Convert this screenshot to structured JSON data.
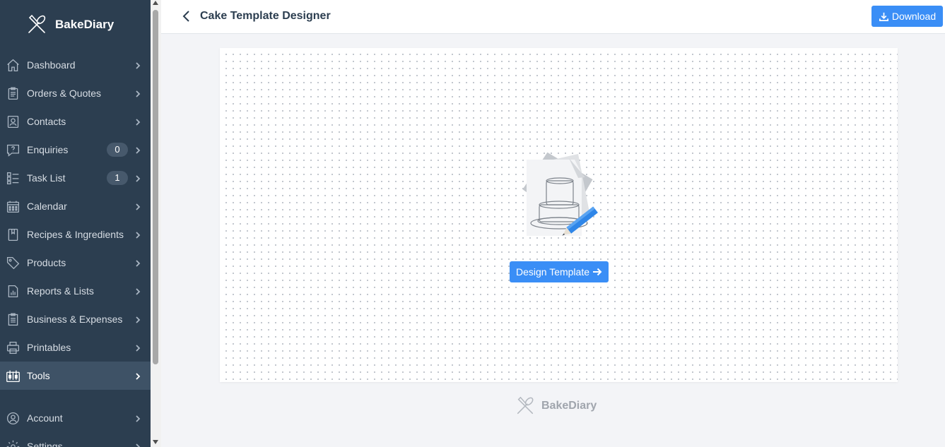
{
  "app": {
    "brand_name": "BakeDiary"
  },
  "sidebar": {
    "items": [
      {
        "label": "Dashboard",
        "icon": "home-icon"
      },
      {
        "label": "Orders & Quotes",
        "icon": "clipboard-icon"
      },
      {
        "label": "Contacts",
        "icon": "contact-card-icon"
      },
      {
        "label": "Enquiries",
        "icon": "question-bubble-icon",
        "badge": "0"
      },
      {
        "label": "Task List",
        "icon": "checklist-icon",
        "badge": "1"
      },
      {
        "label": "Calendar",
        "icon": "calendar-icon"
      },
      {
        "label": "Recipes & Ingredients",
        "icon": "recipe-book-icon"
      },
      {
        "label": "Products",
        "icon": "tag-icon"
      },
      {
        "label": "Reports & Lists",
        "icon": "report-icon"
      },
      {
        "label": "Business & Expenses",
        "icon": "receipt-icon"
      },
      {
        "label": "Printables",
        "icon": "printer-icon"
      },
      {
        "label": "Tools",
        "icon": "tools-icon",
        "active": true
      },
      {
        "label": "Account",
        "icon": "account-icon"
      },
      {
        "label": "Settings",
        "icon": "gear-icon"
      }
    ]
  },
  "header": {
    "title": "Cake Template Designer",
    "download_label": "Download"
  },
  "main": {
    "design_button_label": "Design Template"
  },
  "footer": {
    "brand_name": "BakeDiary"
  },
  "colors": {
    "sidebar_bg": "#2c3e50",
    "sidebar_active": "#3e5266",
    "accent": "#3a8ef6",
    "page_bg": "#f3f4f7"
  }
}
